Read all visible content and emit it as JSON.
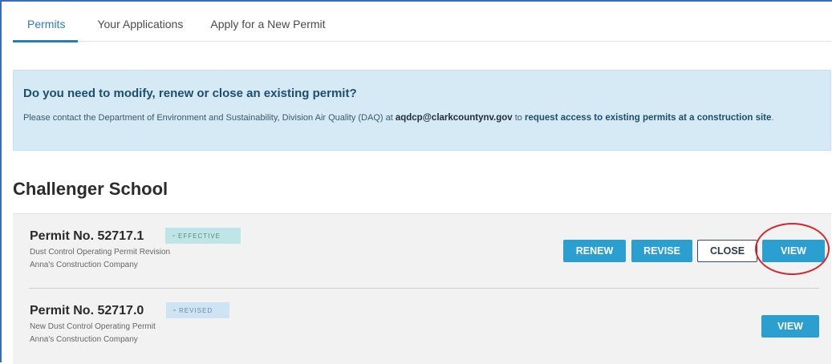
{
  "tabs": [
    {
      "label": "Permits",
      "active": true
    },
    {
      "label": "Your Applications",
      "active": false
    },
    {
      "label": "Apply for a New Permit",
      "active": false
    }
  ],
  "banner": {
    "title": "Do you need to modify, renew or close an existing permit?",
    "text_before": "Please contact the Department of Environment and Sustainability, Division Air Quality (DAQ) at ",
    "email": "aqdcp@clarkcountynv.gov",
    "text_mid": " to ",
    "link": "request access to existing permits at a construction site",
    "text_after": "."
  },
  "site": {
    "title": "Challenger School"
  },
  "permits": [
    {
      "number": "Permit No. 52717.1",
      "status": "EFFECTIVE",
      "type": "Dust Control Operating Permit Revision",
      "company": "Anna's Construction Company",
      "actions": {
        "renew": "RENEW",
        "revise": "REVISE",
        "close": "CLOSE",
        "view": "VIEW"
      }
    },
    {
      "number": "Permit No. 52717.0",
      "status": "REVISED",
      "type": "New Dust Control Operating Permit",
      "company": "Anna's Construction Company",
      "actions": {
        "view": "VIEW"
      }
    }
  ],
  "colors": {
    "accent": "#2b9fd0",
    "banner_bg": "#d6eaf5",
    "highlight_ring": "#d7262b"
  }
}
